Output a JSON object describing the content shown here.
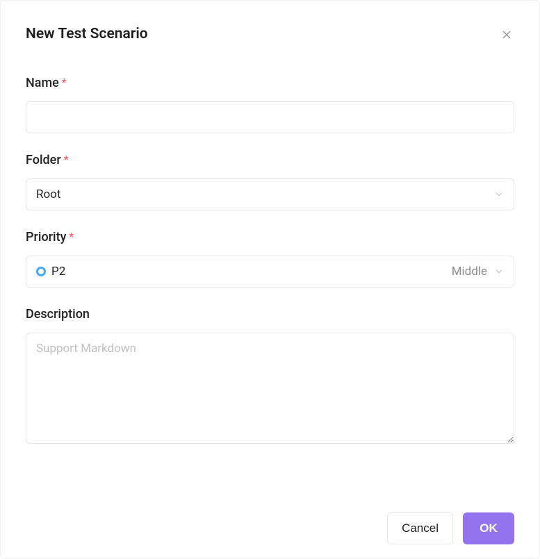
{
  "dialog": {
    "title": "New Test Scenario"
  },
  "fields": {
    "name": {
      "label": "Name",
      "value": ""
    },
    "folder": {
      "label": "Folder",
      "value": "Root"
    },
    "priority": {
      "label": "Priority",
      "value": "P2",
      "secondary": "Middle"
    },
    "description": {
      "label": "Description",
      "placeholder": "Support Markdown",
      "value": ""
    }
  },
  "actions": {
    "cancel": "Cancel",
    "ok": "OK"
  }
}
